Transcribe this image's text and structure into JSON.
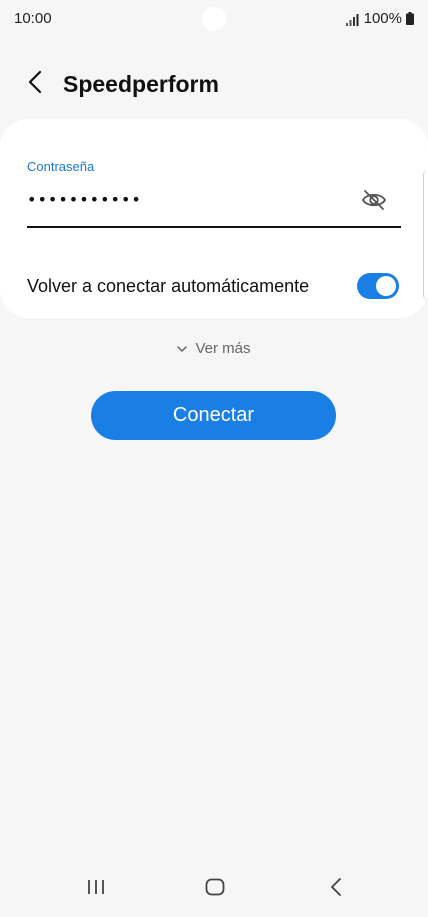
{
  "status_bar": {
    "time": "10:00",
    "battery": "100%"
  },
  "header": {
    "title": "Speedperform"
  },
  "password": {
    "label": "Contraseña",
    "value": "•••••••••••"
  },
  "reconnect": {
    "label": "Volver a conectar automáticamente",
    "enabled": true
  },
  "see_more": {
    "label": "Ver más"
  },
  "connect_button": {
    "label": "Conectar"
  },
  "colors": {
    "accent": "#1a7fe5",
    "label_blue": "#1b79d4",
    "background": "#f6f6f6",
    "card": "#ffffff"
  },
  "icons": {
    "back": "back-arrow-icon",
    "eye": "eye-off-icon",
    "toggle": "toggle-on",
    "see_more": "chevron-down-icon",
    "nav_recent": "recent-apps-icon",
    "nav_home": "home-icon",
    "nav_back": "nav-back-icon"
  }
}
